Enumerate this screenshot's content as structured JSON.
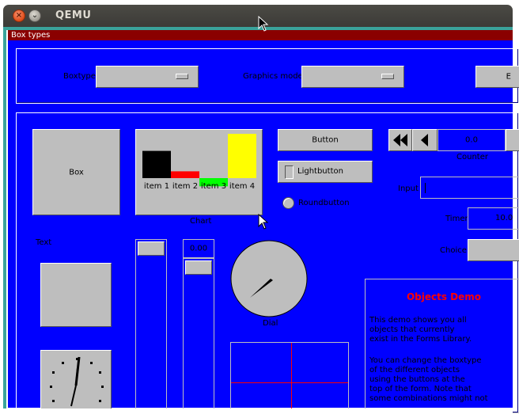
{
  "window": {
    "title": "QEMU",
    "close_glyph": "×",
    "min_glyph": "⌄"
  },
  "form": {
    "title": "Box types"
  },
  "controls": {
    "boxtype_label": "Boxtype",
    "graphics_label": "Graphics mode",
    "third_button_label": "E"
  },
  "objects": {
    "box_label": "Box",
    "chart_label": "Chart",
    "button_label": "Button",
    "lightbutton_label": "Lightbutton",
    "roundbutton_label": "Roundbutton",
    "counter_value": "0.0",
    "counter_label": "Counter",
    "input_label": "Input",
    "timer_label": "Timer",
    "timer_value": "10.0",
    "choice_label": "Choice",
    "text_label": "Text",
    "valslider_value": "0.00",
    "dial_label": "Dial"
  },
  "chart_data": {
    "type": "bar",
    "categories": [
      "item 1",
      "item 2",
      "item 3",
      "item 4"
    ],
    "values": [
      4,
      1,
      -1.2,
      6.5
    ],
    "colors": [
      "#000000",
      "#ff0000",
      "#00ff00",
      "#ffff00"
    ],
    "ylim": [
      -1.2,
      6.5
    ]
  },
  "demo": {
    "title": "Objects Demo",
    "title_color": "#ff0000",
    "para1": [
      "This demo shows you all",
      "objects that currently",
      "exist in the Forms Library."
    ],
    "para2": [
      "You can change the boxtype",
      "of the different objects",
      "using the buttons at the",
      "top of the form. Note that",
      "some combinations might not"
    ]
  },
  "colors": {
    "form_bg": "#0000ff",
    "titlebar": "#8a0000",
    "panel_gray": "#bebebe"
  }
}
